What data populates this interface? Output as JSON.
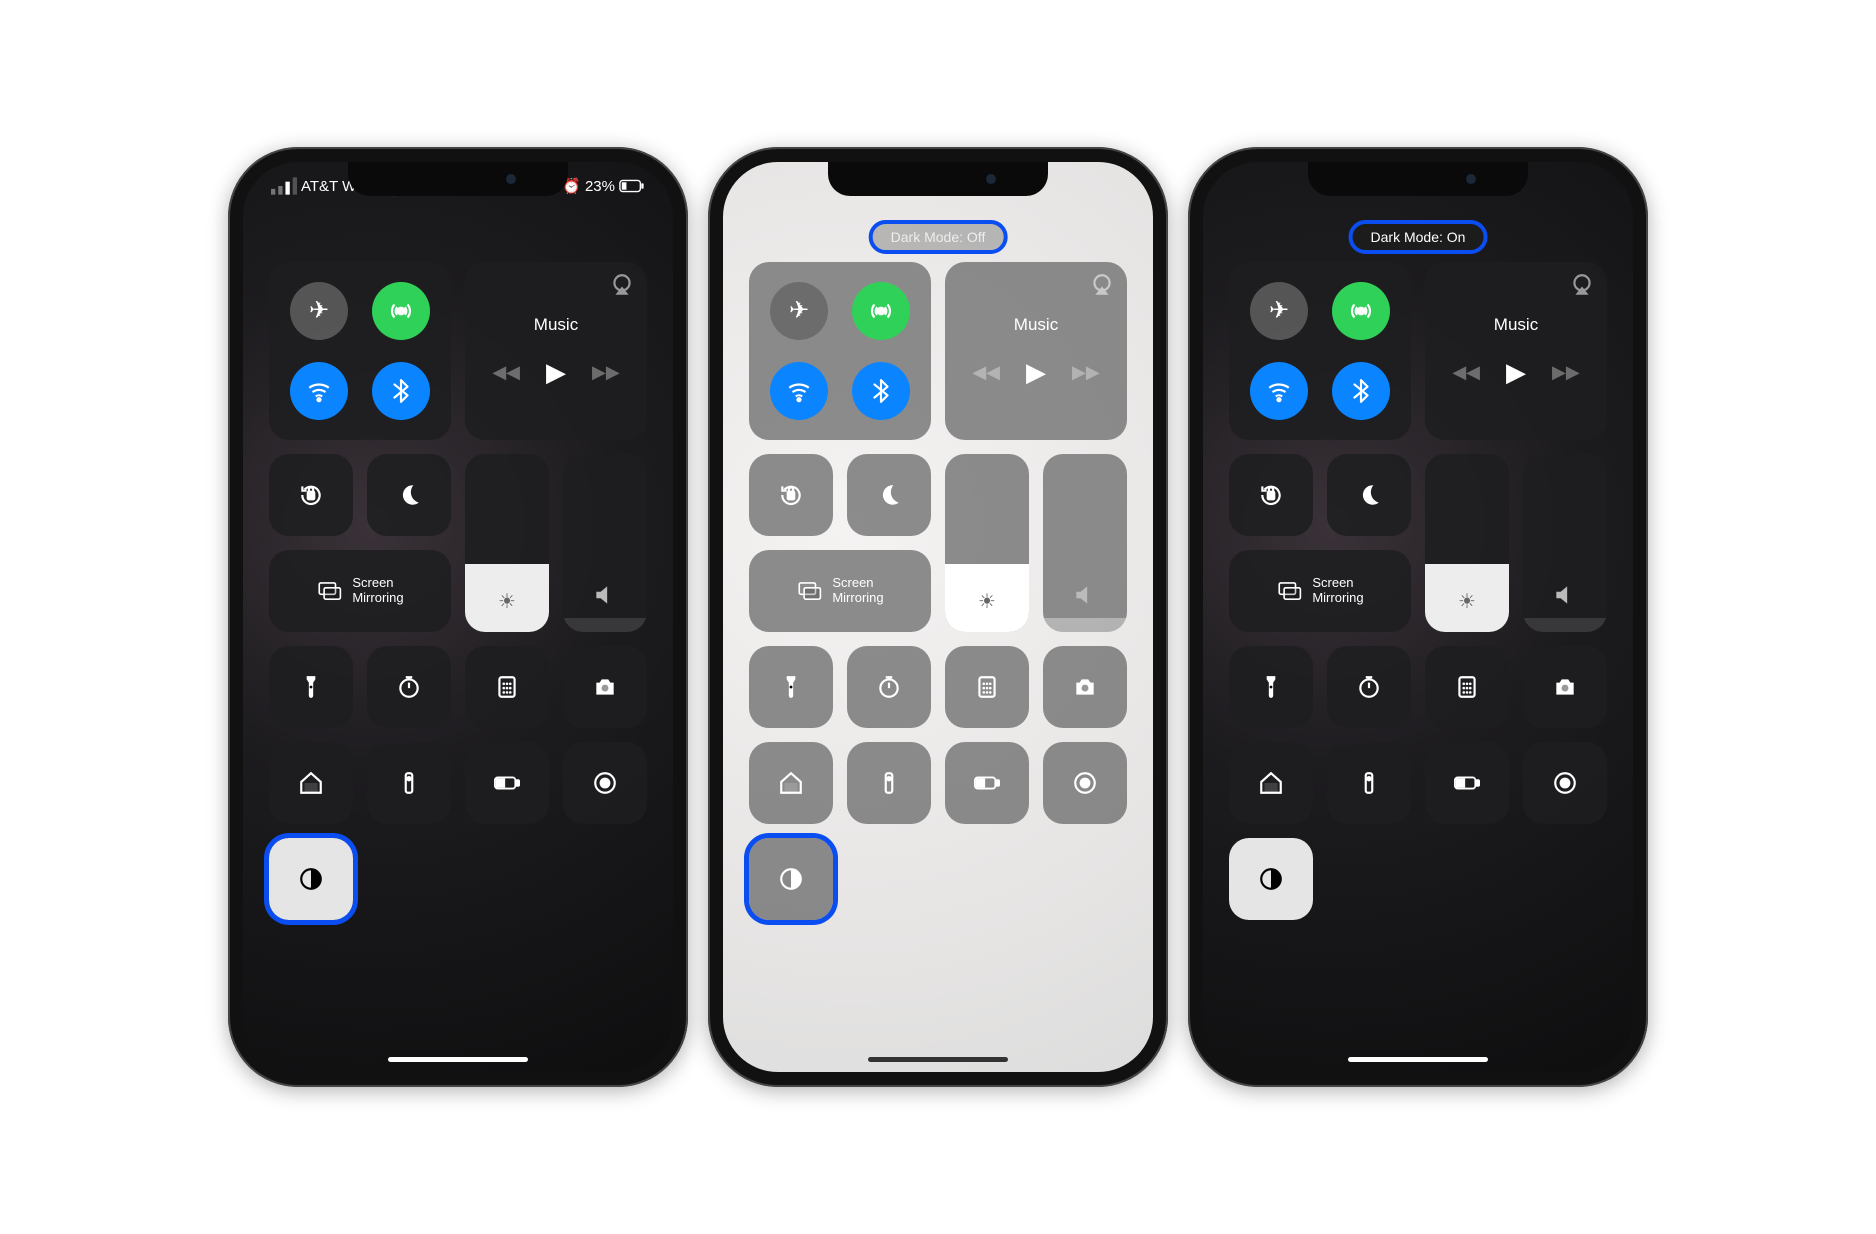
{
  "phones": [
    {
      "id": "phone1",
      "theme": "dark",
      "status": {
        "carrier": "AT&T Wi-Fi",
        "battery_pct": "23%",
        "show_status": true
      },
      "pill": null,
      "dark_mode_tile_active": true,
      "dark_mode_tile_highlighted": true
    },
    {
      "id": "phone2",
      "theme": "light",
      "status": {
        "show_status": false
      },
      "pill": {
        "text": "Dark Mode: Off",
        "style": "light-mode"
      },
      "dark_mode_tile_active": false,
      "dark_mode_tile_highlighted": true
    },
    {
      "id": "phone3",
      "theme": "dark",
      "status": {
        "show_status": false
      },
      "pill": {
        "text": "Dark Mode: On",
        "style": "dark-mode"
      },
      "dark_mode_tile_active": true,
      "dark_mode_tile_highlighted": false
    }
  ],
  "common": {
    "media_label": "Music",
    "screen_mirroring_line1": "Screen",
    "screen_mirroring_line2": "Mirroring",
    "brightness_pct": 38,
    "volume_pct": 8
  },
  "icons": {
    "airplane": "✈︎",
    "cellular": "📶",
    "wifi": "ᯤ",
    "bluetooth": "⌵",
    "lock_rotation": "🔒",
    "dnd": "☾",
    "brightness": "☀︎",
    "volume": "🔈",
    "flashlight": "🔦",
    "timer": "⏱",
    "calculator": "▦",
    "camera": "📷",
    "home": "⌂",
    "remote": "▯",
    "low_power": "🔋",
    "screen_record": "◉",
    "dark_mode": "◐",
    "airplay": "⎋",
    "alarm": "⏰",
    "play": "▶︎",
    "rewind": "◀◀",
    "forward": "▶▶",
    "screen_mirror": "⧉"
  }
}
